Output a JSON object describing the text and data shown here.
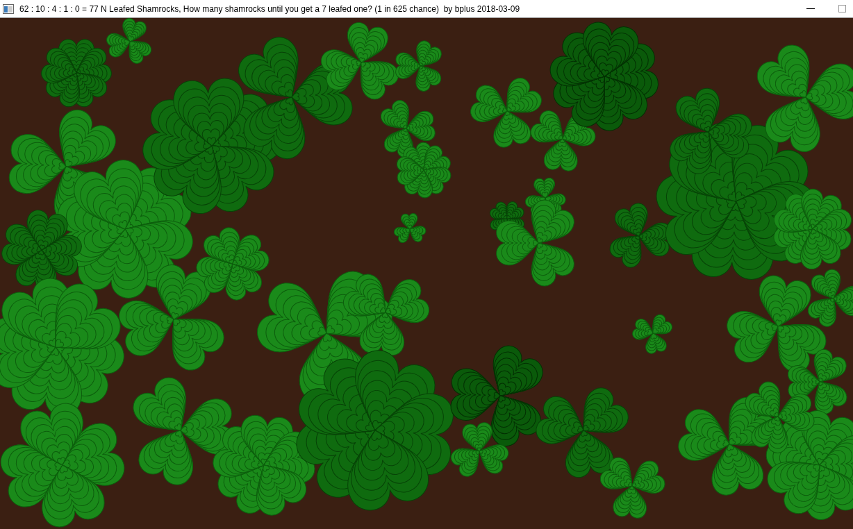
{
  "window": {
    "title": "62 : 10 : 4 : 1 : 0 = 77 N Leafed Shamrocks, How many shamrocks until you get a 7 leafed one? (1 in 625 chance)  by bplus 2018-03-09"
  }
}
